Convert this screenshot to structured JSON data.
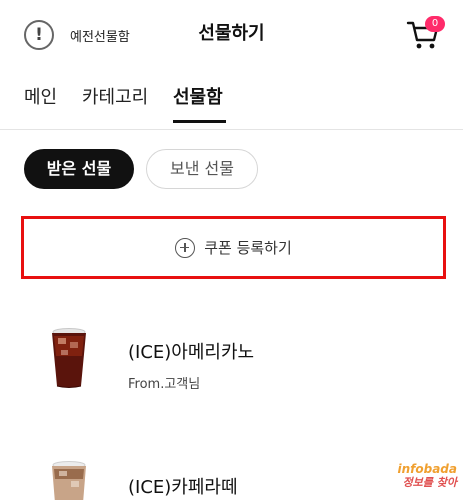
{
  "header": {
    "legacy_box_label": "예전선물함",
    "title": "선물하기",
    "cart_count": "0"
  },
  "tabs": [
    {
      "label": "메인",
      "active": false
    },
    {
      "label": "카테고리",
      "active": false
    },
    {
      "label": "선물함",
      "active": true
    }
  ],
  "segments": {
    "received": "받은 선물",
    "sent": "보낸 선물"
  },
  "coupon": {
    "label": "쿠폰 등록하기"
  },
  "gifts": [
    {
      "name": "(ICE)아메리카노",
      "from": "From.고객님"
    },
    {
      "name": "(ICE)카페라떼"
    }
  ],
  "watermark": {
    "line1": "infobada",
    "line2": "정보를 찾아"
  },
  "colors": {
    "badge": "#ff2b6a",
    "highlight_border": "#e81010",
    "active_segment": "#111111"
  }
}
